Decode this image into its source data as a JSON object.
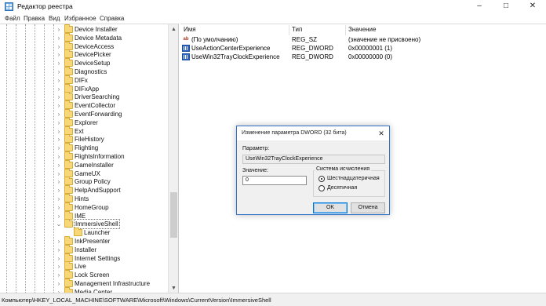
{
  "window": {
    "title": "Редактор реестра",
    "minimize": "–",
    "maximize": "□",
    "close": "✕"
  },
  "menu": [
    "Файл",
    "Правка",
    "Вид",
    "Избранное",
    "Справка"
  ],
  "tree": [
    {
      "label": "Device Installer",
      "expander": "›"
    },
    {
      "label": "Device Metadata",
      "expander": "›"
    },
    {
      "label": "DeviceAccess",
      "expander": "›"
    },
    {
      "label": "DevicePicker",
      "expander": "›"
    },
    {
      "label": "DeviceSetup",
      "expander": "›"
    },
    {
      "label": "Diagnostics",
      "expander": "›"
    },
    {
      "label": "DIFx",
      "expander": "›"
    },
    {
      "label": "DIFxApp",
      "expander": "›"
    },
    {
      "label": "DriverSearching",
      "expander": "›"
    },
    {
      "label": "EventCollector",
      "expander": "›"
    },
    {
      "label": "EventForwarding",
      "expander": "›"
    },
    {
      "label": "Explorer",
      "expander": "›"
    },
    {
      "label": "Ext",
      "expander": "›"
    },
    {
      "label": "FileHistory",
      "expander": "›"
    },
    {
      "label": "Flighting",
      "expander": "›"
    },
    {
      "label": "FlightsInformation",
      "expander": "›"
    },
    {
      "label": "GameInstaller",
      "expander": "›"
    },
    {
      "label": "GameUX",
      "expander": "›"
    },
    {
      "label": "Group Policy",
      "expander": "›"
    },
    {
      "label": "HelpAndSupport",
      "expander": "›"
    },
    {
      "label": "Hints",
      "expander": "›"
    },
    {
      "label": "HomeGroup",
      "expander": "›"
    },
    {
      "label": "IME",
      "expander": "›"
    },
    {
      "label": "ImmersiveShell",
      "expander": "⌄"
    },
    {
      "label": "Launcher",
      "expander": ""
    },
    {
      "label": "InkPresenter",
      "expander": "›"
    },
    {
      "label": "Installer",
      "expander": "›"
    },
    {
      "label": "Internet Settings",
      "expander": "›"
    },
    {
      "label": "Live",
      "expander": "›"
    },
    {
      "label": "Lock Screen",
      "expander": "›"
    },
    {
      "label": "Management Infrastructure",
      "expander": "›"
    },
    {
      "label": "Media Center",
      "expander": "›"
    }
  ],
  "columns": {
    "name": "Имя",
    "type": "Тип",
    "data": "Значение"
  },
  "values": [
    {
      "icon": "ab",
      "name": "(По умолчанию)",
      "type": "REG_SZ",
      "data": "(значение не присвоено)"
    },
    {
      "icon": "",
      "name": "UseActionCenterExperience",
      "type": "REG_DWORD",
      "data": "0x00000001 (1)"
    },
    {
      "icon": "",
      "name": "UseWin32TrayClockExperience",
      "type": "REG_DWORD",
      "data": "0x00000000 (0)"
    }
  ],
  "status_path": "Компьютер\\HKEY_LOCAL_MACHINE\\SOFTWARE\\Microsoft\\Windows\\CurrentVersion\\ImmersiveShell",
  "dialog": {
    "title": "Изменение параметра DWORD (32 бита)",
    "close": "✕",
    "param_label": "Параметр:",
    "param_value": "UseWin32TrayClockExperience",
    "value_label": "Значение:",
    "value": "0",
    "radix_title": "Система исчисления",
    "radix_hex": "Шестнадцатеричная",
    "radix_dec": "Десятичная",
    "ok": "OK",
    "cancel": "Отмена"
  },
  "scroll": {
    "up": "▲",
    "down": "▼"
  }
}
